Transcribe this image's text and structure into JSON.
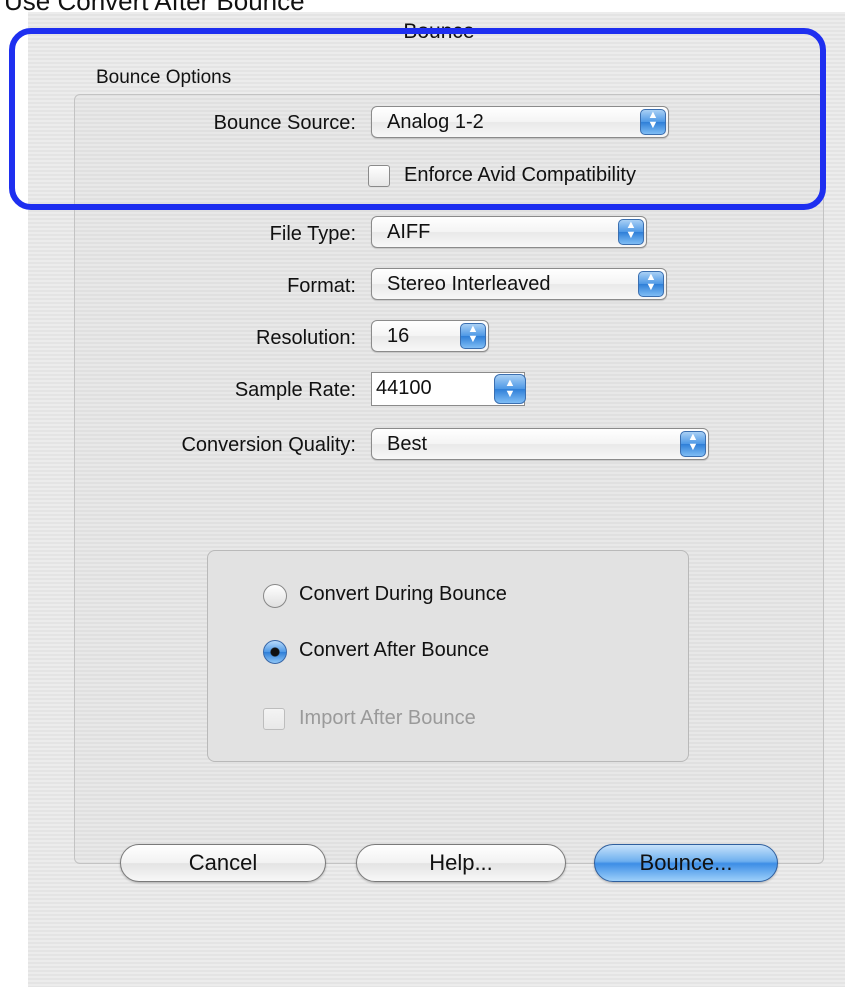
{
  "caption": "Use Convert After Bounce",
  "window": {
    "title": "Bounce"
  },
  "group": {
    "title": "Bounce Options"
  },
  "fields": {
    "bounce_source": {
      "label": "Bounce Source:",
      "value": "Analog 1-2"
    },
    "avid": {
      "label": "Enforce Avid Compatibility",
      "checked": false
    },
    "file_type": {
      "label": "File Type:",
      "value": "AIFF"
    },
    "format": {
      "label": "Format:",
      "value": "Stereo Interleaved"
    },
    "resolution": {
      "label": "Resolution:",
      "value": "16"
    },
    "sample_rate": {
      "label": "Sample Rate:",
      "value": "44100"
    },
    "conversion_quality": {
      "label": "Conversion Quality:",
      "value": "Best"
    }
  },
  "conversion": {
    "options": [
      "Convert During Bounce",
      "Convert After Bounce"
    ],
    "selected": "Convert After Bounce",
    "import_label": "Import After Bounce",
    "import_enabled": false
  },
  "buttons": {
    "cancel": "Cancel",
    "help": "Help...",
    "bounce": "Bounce..."
  },
  "colors": {
    "highlight": "#1e2ff0",
    "accent": "#3d8ee6"
  }
}
